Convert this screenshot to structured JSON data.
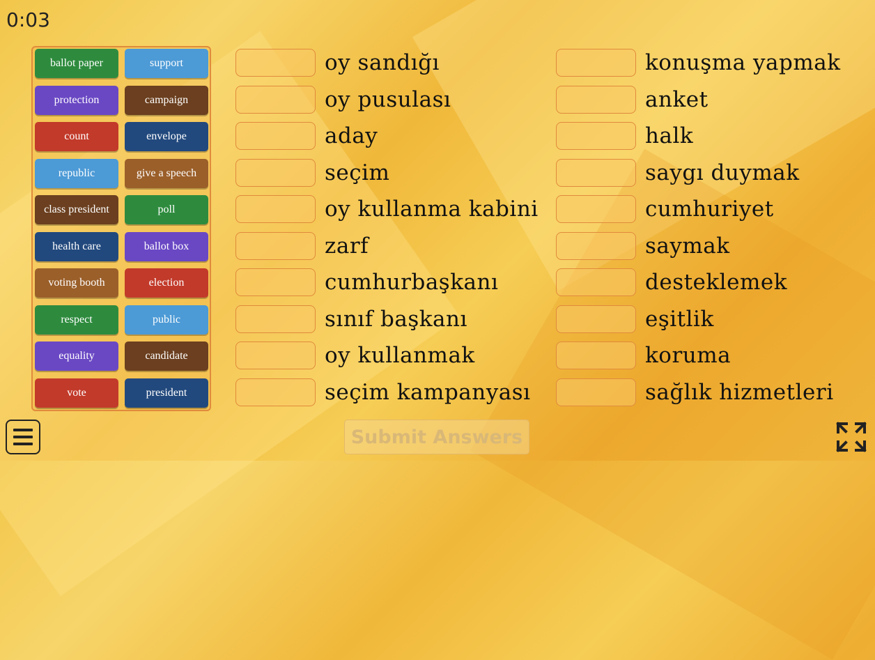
{
  "timer": "0:03",
  "cards": [
    {
      "label": "ballot paper",
      "color": "#2e8b3e"
    },
    {
      "label": "support",
      "color": "#4c9ad6"
    },
    {
      "label": "protection",
      "color": "#6a48c4"
    },
    {
      "label": "campaign",
      "color": "#6b3f1f"
    },
    {
      "label": "count",
      "color": "#c23a2a"
    },
    {
      "label": "envelope",
      "color": "#22497d"
    },
    {
      "label": "republic",
      "color": "#4c9ad6"
    },
    {
      "label": "give a speech",
      "color": "#9b5f2a"
    },
    {
      "label": "class president",
      "color": "#6b3f1f"
    },
    {
      "label": "poll",
      "color": "#2e8b3e"
    },
    {
      "label": "health care",
      "color": "#22497d"
    },
    {
      "label": "ballot box",
      "color": "#6a48c4"
    },
    {
      "label": "voting booth",
      "color": "#9b5f2a"
    },
    {
      "label": "election",
      "color": "#c23a2a"
    },
    {
      "label": "respect",
      "color": "#2e8b3e"
    },
    {
      "label": "public",
      "color": "#4c9ad6"
    },
    {
      "label": "equality",
      "color": "#6a48c4"
    },
    {
      "label": "candidate",
      "color": "#6b3f1f"
    },
    {
      "label": "vote",
      "color": "#c23a2a"
    },
    {
      "label": "president",
      "color": "#22497d"
    }
  ],
  "left_words": [
    "oy sandığı",
    "oy pusulası",
    "aday",
    "seçim",
    "oy kullanma kabini",
    "zarf",
    "cumhurbaşkanı",
    "sınıf başkanı",
    "oy kullanmak",
    "seçim kampanyası"
  ],
  "right_words": [
    "konuşma yapmak",
    "anket",
    "halk",
    "saygı duymak",
    "cumhuriyet",
    "saymak",
    "desteklemek",
    "eşitlik",
    "koruma",
    "sağlık hizmetleri"
  ],
  "submit_label": "Submit Answers",
  "icons": {
    "menu": "hamburger-menu-icon",
    "fullscreen": "fullscreen-expand-icon"
  }
}
